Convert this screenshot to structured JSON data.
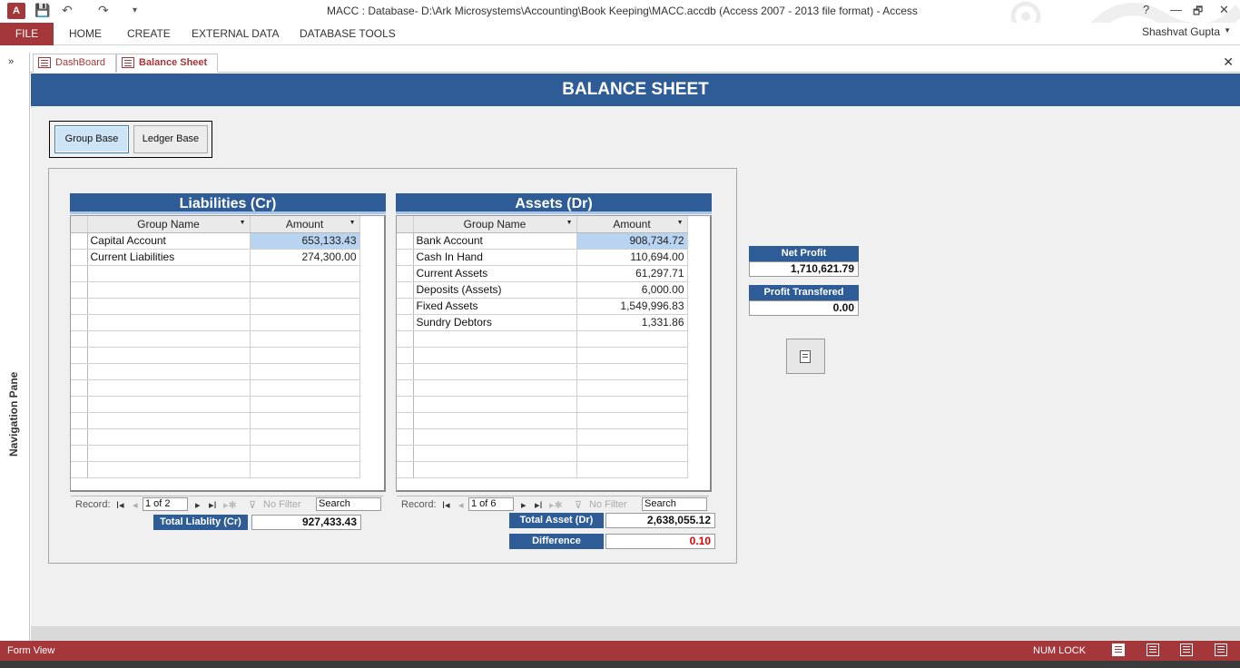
{
  "window": {
    "title": "MACC : Database- D:\\Ark Microsystems\\Accounting\\Book Keeping\\MACC.accdb (Access 2007 - 2013 file format) - Access",
    "app_icon": "A",
    "help": "?",
    "minimize": "—",
    "restore": "🗗",
    "close": "✕"
  },
  "qat": {
    "save": "💾",
    "undo": "↶",
    "redo": "↷",
    "customize": "▾"
  },
  "ribbon": {
    "tabs": [
      "FILE",
      "HOME",
      "CREATE",
      "EXTERNAL DATA",
      "DATABASE TOOLS"
    ],
    "user": "Shashvat Gupta"
  },
  "nav_pane": {
    "label": "Navigation Pane",
    "expand": "»"
  },
  "doc_tabs": [
    "DashBoard",
    "Balance Sheet"
  ],
  "doc_close": "✕",
  "form": {
    "title": "BALANCE SHEET",
    "toggle": {
      "group_base": "Group Base",
      "ledger_base": "Ledger Base",
      "selected": "Group Base"
    },
    "liabilities": {
      "title": "Liabilities (Cr)",
      "columns": [
        "Group Name",
        "Amount"
      ],
      "rows": [
        {
          "name": "Capital Account",
          "amount": "653,133.43"
        },
        {
          "name": "Current Liabilities",
          "amount": "274,300.00"
        }
      ],
      "record_label": "Record:",
      "record_pos": "1 of 2",
      "filter": "No Filter",
      "search": "Search",
      "total_label": "Total Liablity (Cr)",
      "total_value": "927,433.43"
    },
    "assets": {
      "title": "Assets (Dr)",
      "columns": [
        "Group Name",
        "Amount"
      ],
      "rows": [
        {
          "name": "Bank Account",
          "amount": "908,734.72"
        },
        {
          "name": "Cash In Hand",
          "amount": "110,694.00"
        },
        {
          "name": "Current Assets",
          "amount": "61,297.71"
        },
        {
          "name": "Deposits (Assets)",
          "amount": "6,000.00"
        },
        {
          "name": "Fixed Assets",
          "amount": "1,549,996.83"
        },
        {
          "name": "Sundry Debtors",
          "amount": "1,331.86"
        }
      ],
      "record_label": "Record:",
      "record_pos": "1 of 6",
      "filter": "No Filter",
      "search": "Search",
      "total_label": "Total Asset (Dr)",
      "total_value": "2,638,055.12"
    },
    "difference_label": "Difference",
    "difference_value": "0.10",
    "net_profit_label": "Net Profit",
    "net_profit_value": "1,710,621.79",
    "profit_transfered_label": "Profit Transfered",
    "profit_transfered_value": "0.00"
  },
  "status": {
    "left": "Form View",
    "numlock": "NUM LOCK"
  },
  "colors": {
    "brand": "#a4373a",
    "header_blue": "#2e5c97",
    "selection": "#b8d4f1",
    "difference_red": "#e00000"
  }
}
